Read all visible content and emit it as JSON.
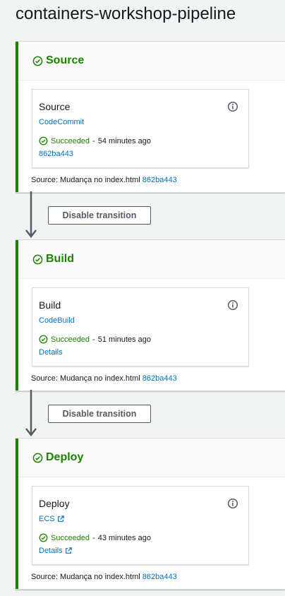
{
  "pipeline": {
    "title": "containers-workshop-pipeline"
  },
  "colors": {
    "success": "#1d8102",
    "link": "#0073bb",
    "stage_bar": "#1d8102"
  },
  "stages": [
    {
      "name": "Source",
      "action": {
        "name": "Source",
        "provider": "CodeCommit",
        "status": "Succeeded",
        "time": "54 minutes ago",
        "sub_link": "862ba443"
      },
      "footer": {
        "prefix": "Source: Mudança no index.html",
        "revision": "862ba443"
      }
    },
    {
      "name": "Build",
      "action": {
        "name": "Build",
        "provider": "CodeBuild",
        "status": "Succeeded",
        "time": "51 minutes ago",
        "sub_link": "Details"
      },
      "footer": {
        "prefix": "Source: Mudança no index.html",
        "revision": "862ba443"
      }
    },
    {
      "name": "Deploy",
      "action": {
        "name": "Deploy",
        "provider": "ECS",
        "status": "Succeeded",
        "time": "43 minutes ago",
        "sub_link": "Details"
      },
      "footer": {
        "prefix": "Source: Mudança no index.html",
        "revision": "862ba443"
      }
    }
  ],
  "transitions": [
    {
      "label": "Disable transition"
    },
    {
      "label": "Disable transition"
    }
  ],
  "status_separator": "-"
}
